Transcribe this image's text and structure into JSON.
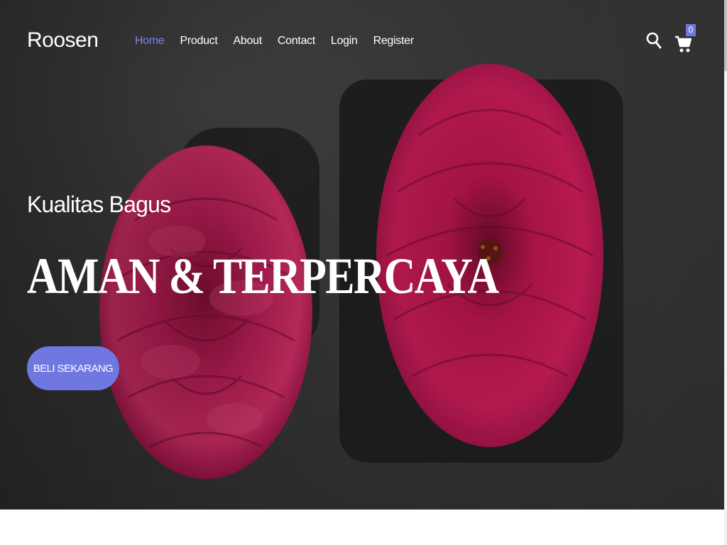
{
  "brand": {
    "name": "Roosen"
  },
  "nav": {
    "items": [
      {
        "label": "Home",
        "active": true
      },
      {
        "label": "Product",
        "active": false
      },
      {
        "label": "About",
        "active": false
      },
      {
        "label": "Contact",
        "active": false
      },
      {
        "label": "Login",
        "active": false
      },
      {
        "label": "Register",
        "active": false
      }
    ]
  },
  "icons": {
    "search": "search-icon",
    "cart": "cart-icon"
  },
  "cart": {
    "count": "0"
  },
  "hero": {
    "subtitle": "Kualitas Bagus",
    "title": "AMAN & TERPERCAYA",
    "cta_label": "BELI SEKARANG"
  },
  "colors": {
    "accent": "#6f77e0",
    "nav_active": "#7b83eb",
    "rose": "#b0164f",
    "background_dark": "#2e2e2e"
  }
}
